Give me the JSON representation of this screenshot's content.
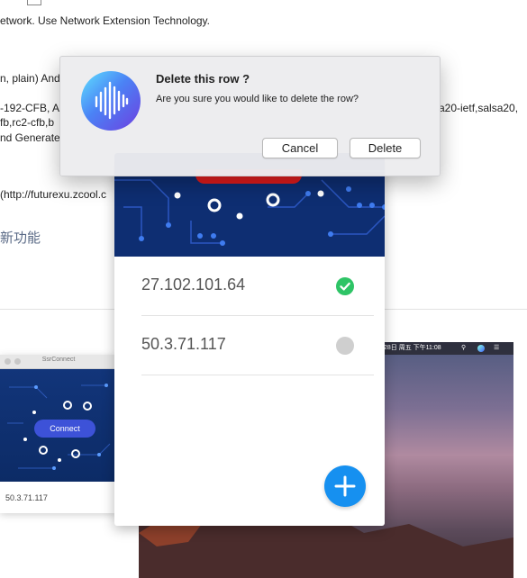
{
  "background": {
    "line1": "etwork. Use Network Extension Technology.",
    "line2": "n, plain) And",
    "line3a": "-192-CFB, A",
    "line3b": "a20-ietf,salsa20,",
    "line4": "fb,rc2-cfb,b",
    "line5": "nd Generate",
    "line6": "(http://futurexu.zcool.c",
    "feature_heading": "新功能"
  },
  "mini_window": {
    "title": "SsrConnect",
    "connect_label": "Connect",
    "server_ip": "50.3.71.117"
  },
  "desktop": {
    "clock": "28日 周五 下午11:08"
  },
  "app": {
    "servers": [
      {
        "ip": "27.102.101.64",
        "status": "connected"
      },
      {
        "ip": "50.3.71.117",
        "status": "disconnected"
      }
    ],
    "add_icon": "plus-icon"
  },
  "alert": {
    "title": "Delete this row ?",
    "message": "Are you sure you would like to delete the row?",
    "cancel_label": "Cancel",
    "delete_label": "Delete",
    "icon": "audio-wave-icon"
  },
  "colors": {
    "accent": "#1690f0",
    "connected": "#2ec466",
    "disconnected": "#cfcfcf",
    "board": "#0e2e72",
    "board_red": "#e11b1b"
  }
}
